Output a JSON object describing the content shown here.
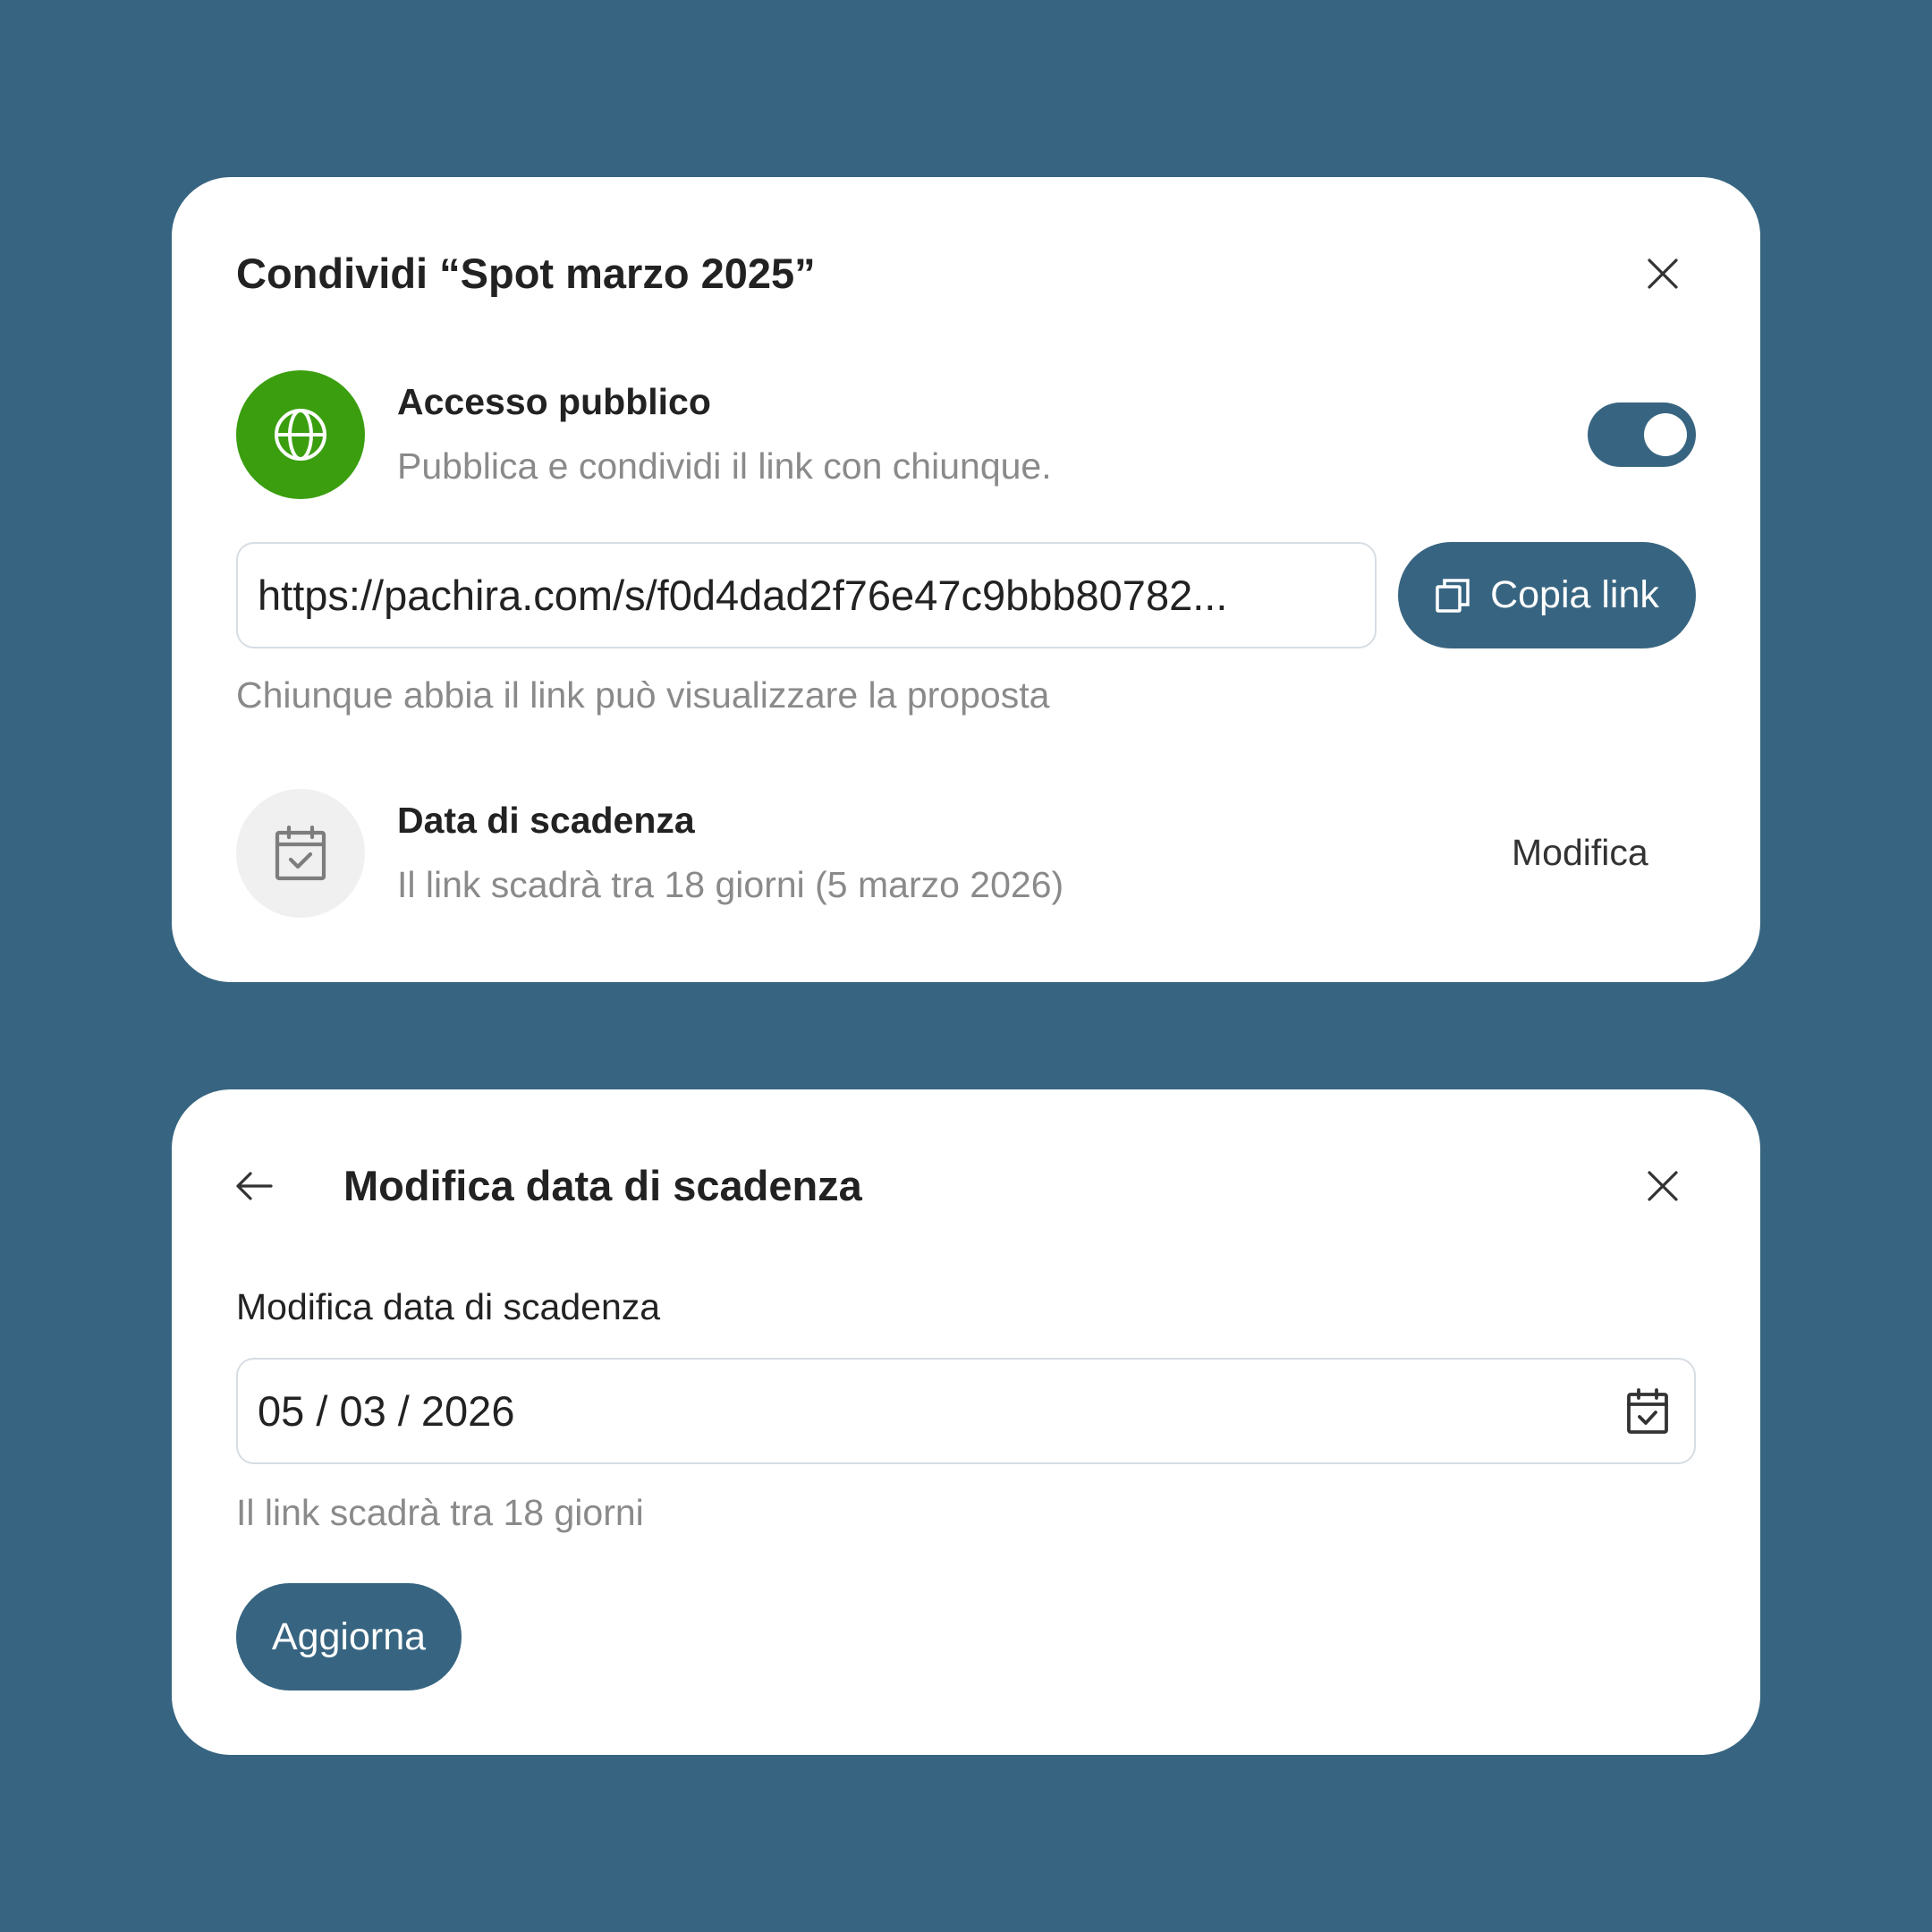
{
  "share_dialog": {
    "title": "Condividi “Spot marzo 2025”",
    "public_access": {
      "title": "Accesso pubblico",
      "description": "Pubblica e condividi il link con chiunque.",
      "enabled": true
    },
    "link": {
      "value": "https://pachira.com/s/f0d4dad2f76e47c9bbb80782...",
      "copy_label": "Copia link",
      "hint": "Chiunque abbia il link può visualizzare la proposta"
    },
    "expiry": {
      "title": "Data di scadenza",
      "description": "Il link scadrà tra 18 giorni (5 marzo 2026)",
      "edit_label": "Modifica"
    }
  },
  "expiry_dialog": {
    "title": "Modifica data di scadenza",
    "field_label": "Modifica data di scadenza",
    "date_value": "05 / 03 / 2026",
    "hint": "Il link scadrà tra 18 giorni",
    "submit_label": "Aggiorna"
  },
  "colors": {
    "background": "#376581",
    "accent": "#376581",
    "public_green": "#3a9e0f",
    "muted_text": "#8a8a8a"
  },
  "icons": [
    "close-icon",
    "globe-icon",
    "copy-icon",
    "calendar-icon",
    "arrow-left-icon"
  ]
}
